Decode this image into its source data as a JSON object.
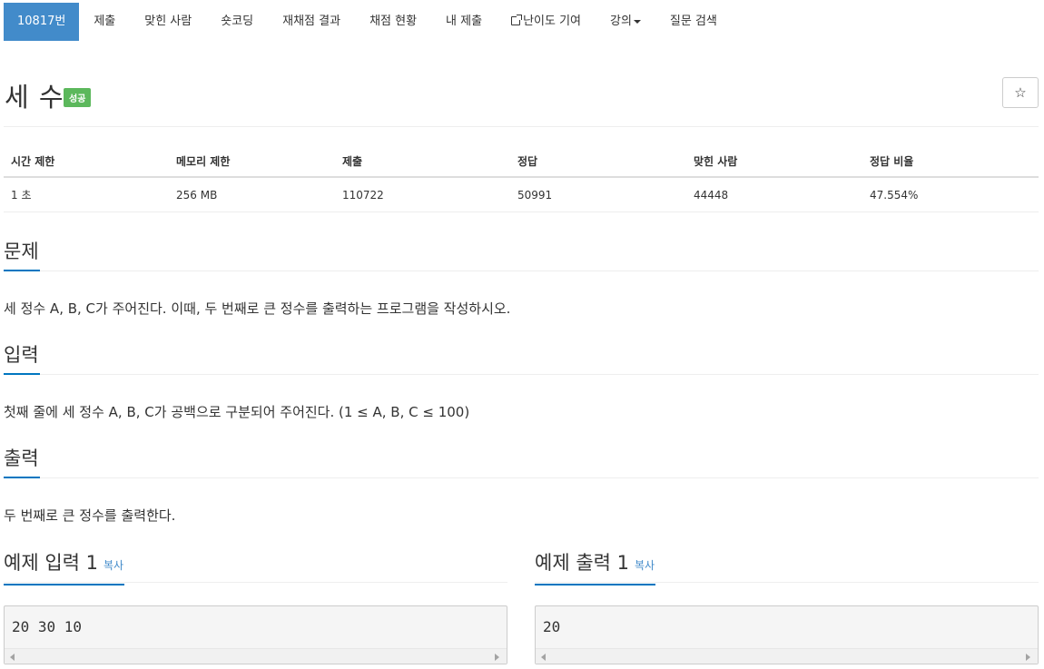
{
  "nav": {
    "items": [
      {
        "label": "10817번"
      },
      {
        "label": "제출"
      },
      {
        "label": "맞힌 사람"
      },
      {
        "label": "숏코딩"
      },
      {
        "label": "재채점 결과"
      },
      {
        "label": "채점 현황"
      },
      {
        "label": "내 제출"
      },
      {
        "label": "난이도 기여",
        "icon": "external-link-icon"
      },
      {
        "label": "강의",
        "icon": "caret-down-icon"
      },
      {
        "label": "질문 검색"
      }
    ]
  },
  "problem": {
    "title": "세 수",
    "badge": "성공",
    "badge_color": "#5cb85c",
    "star_icon": "☆"
  },
  "info_table": {
    "headers": [
      "시간 제한",
      "메모리 제한",
      "제출",
      "정답",
      "맞힌 사람",
      "정답 비율"
    ],
    "row": [
      "1 초",
      "256 MB",
      "110722",
      "50991",
      "44448",
      "47.554%"
    ]
  },
  "sections": {
    "problem_heading": "문제",
    "problem_text": "세 정수 A, B, C가 주어진다. 이때, 두 번째로 큰 정수를 출력하는 프로그램을 작성하시오.",
    "input_heading": "입력",
    "input_text": "첫째 줄에 세 정수 A, B, C가 공백으로 구분되어 주어진다. (1 ≤ A, B, C ≤ 100)",
    "output_heading": "출력",
    "output_text": "두 번째로 큰 정수를 출력한다."
  },
  "samples": {
    "input_heading": "예제 입력 1",
    "output_heading": "예제 출력 1",
    "copy_label": "복사",
    "input_value": "20 30 10",
    "output_value": "20"
  },
  "colors": {
    "accent": "#428bca",
    "underline": "#0076c0"
  }
}
